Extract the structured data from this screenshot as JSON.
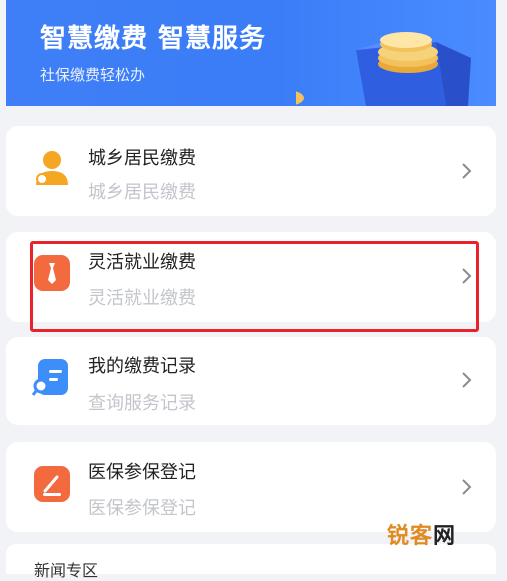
{
  "banner": {
    "title": "智慧缴费  智慧服务",
    "subtitle": "社保缴费轻松办"
  },
  "services": [
    {
      "title": "城乡居民缴费",
      "subtitle": "城乡居民缴费",
      "icon": "person-icon",
      "color": "#f5a623"
    },
    {
      "title": "灵活就业缴费",
      "subtitle": "灵活就业缴费",
      "icon": "tie-icon",
      "color": "#f26a3d"
    },
    {
      "title": "我的缴费记录",
      "subtitle": "查询服务记录",
      "icon": "record-search-icon",
      "color": "#3d8ef8"
    },
    {
      "title": "医保参保登记",
      "subtitle": "医保参保登记",
      "icon": "edit-form-icon",
      "color": "#f26a3d"
    }
  ],
  "bottom": {
    "title": "新闻专区"
  },
  "watermark": {
    "part1": "锐客",
    "part2": "网"
  },
  "highlight_color": "#e8232a"
}
